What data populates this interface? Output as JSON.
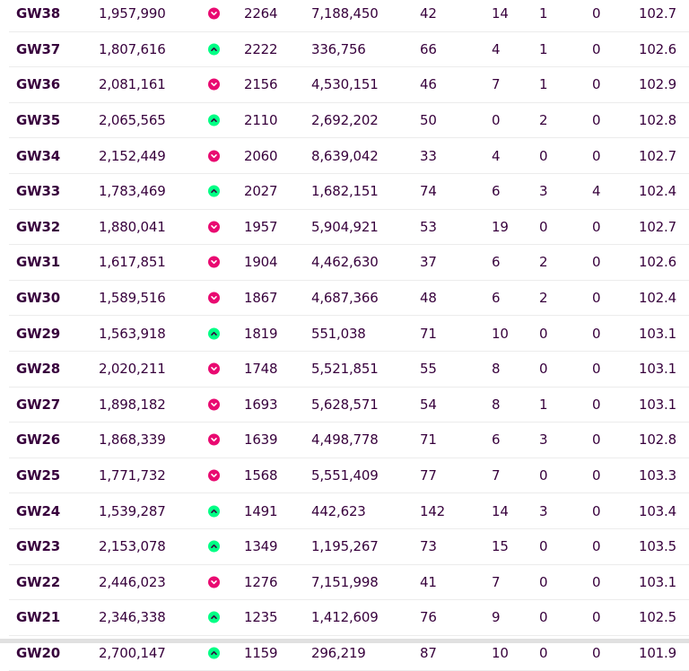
{
  "colors": {
    "down": "#e90a71",
    "up": "#00ff85",
    "text": "#37003c"
  },
  "rows": [
    {
      "gw": "GW38",
      "points": "1,957,990",
      "trend": "down",
      "rank": "2264",
      "transfers": "7,188,450",
      "a": "42",
      "b": "14",
      "c": "1",
      "d": "0",
      "value": "102.7"
    },
    {
      "gw": "GW37",
      "points": "1,807,616",
      "trend": "up",
      "rank": "2222",
      "transfers": "336,756",
      "a": "66",
      "b": "4",
      "c": "1",
      "d": "0",
      "value": "102.6"
    },
    {
      "gw": "GW36",
      "points": "2,081,161",
      "trend": "down",
      "rank": "2156",
      "transfers": "4,530,151",
      "a": "46",
      "b": "7",
      "c": "1",
      "d": "0",
      "value": "102.9"
    },
    {
      "gw": "GW35",
      "points": "2,065,565",
      "trend": "up",
      "rank": "2110",
      "transfers": "2,692,202",
      "a": "50",
      "b": "0",
      "c": "2",
      "d": "0",
      "value": "102.8"
    },
    {
      "gw": "GW34",
      "points": "2,152,449",
      "trend": "down",
      "rank": "2060",
      "transfers": "8,639,042",
      "a": "33",
      "b": "4",
      "c": "0",
      "d": "0",
      "value": "102.7"
    },
    {
      "gw": "GW33",
      "points": "1,783,469",
      "trend": "up",
      "rank": "2027",
      "transfers": "1,682,151",
      "a": "74",
      "b": "6",
      "c": "3",
      "d": "4",
      "value": "102.4"
    },
    {
      "gw": "GW32",
      "points": "1,880,041",
      "trend": "down",
      "rank": "1957",
      "transfers": "5,904,921",
      "a": "53",
      "b": "19",
      "c": "0",
      "d": "0",
      "value": "102.7"
    },
    {
      "gw": "GW31",
      "points": "1,617,851",
      "trend": "down",
      "rank": "1904",
      "transfers": "4,462,630",
      "a": "37",
      "b": "6",
      "c": "2",
      "d": "0",
      "value": "102.6"
    },
    {
      "gw": "GW30",
      "points": "1,589,516",
      "trend": "down",
      "rank": "1867",
      "transfers": "4,687,366",
      "a": "48",
      "b": "6",
      "c": "2",
      "d": "0",
      "value": "102.4"
    },
    {
      "gw": "GW29",
      "points": "1,563,918",
      "trend": "up",
      "rank": "1819",
      "transfers": "551,038",
      "a": "71",
      "b": "10",
      "c": "0",
      "d": "0",
      "value": "103.1"
    },
    {
      "gw": "GW28",
      "points": "2,020,211",
      "trend": "down",
      "rank": "1748",
      "transfers": "5,521,851",
      "a": "55",
      "b": "8",
      "c": "0",
      "d": "0",
      "value": "103.1"
    },
    {
      "gw": "GW27",
      "points": "1,898,182",
      "trend": "down",
      "rank": "1693",
      "transfers": "5,628,571",
      "a": "54",
      "b": "8",
      "c": "1",
      "d": "0",
      "value": "103.1"
    },
    {
      "gw": "GW26",
      "points": "1,868,339",
      "trend": "down",
      "rank": "1639",
      "transfers": "4,498,778",
      "a": "71",
      "b": "6",
      "c": "3",
      "d": "0",
      "value": "102.8"
    },
    {
      "gw": "GW25",
      "points": "1,771,732",
      "trend": "down",
      "rank": "1568",
      "transfers": "5,551,409",
      "a": "77",
      "b": "7",
      "c": "0",
      "d": "0",
      "value": "103.3"
    },
    {
      "gw": "GW24",
      "points": "1,539,287",
      "trend": "up",
      "rank": "1491",
      "transfers": "442,623",
      "a": "142",
      "b": "14",
      "c": "3",
      "d": "0",
      "value": "103.4"
    },
    {
      "gw": "GW23",
      "points": "2,153,078",
      "trend": "up",
      "rank": "1349",
      "transfers": "1,195,267",
      "a": "73",
      "b": "15",
      "c": "0",
      "d": "0",
      "value": "103.5"
    },
    {
      "gw": "GW22",
      "points": "2,446,023",
      "trend": "down",
      "rank": "1276",
      "transfers": "7,151,998",
      "a": "41",
      "b": "7",
      "c": "0",
      "d": "0",
      "value": "103.1"
    },
    {
      "gw": "GW21",
      "points": "2,346,338",
      "trend": "up",
      "rank": "1235",
      "transfers": "1,412,609",
      "a": "76",
      "b": "9",
      "c": "0",
      "d": "0",
      "value": "102.5"
    },
    {
      "gw": "GW20",
      "points": "2,700,147",
      "trend": "up",
      "rank": "1159",
      "transfers": "296,219",
      "a": "87",
      "b": "10",
      "c": "0",
      "d": "0",
      "value": "101.9"
    }
  ]
}
